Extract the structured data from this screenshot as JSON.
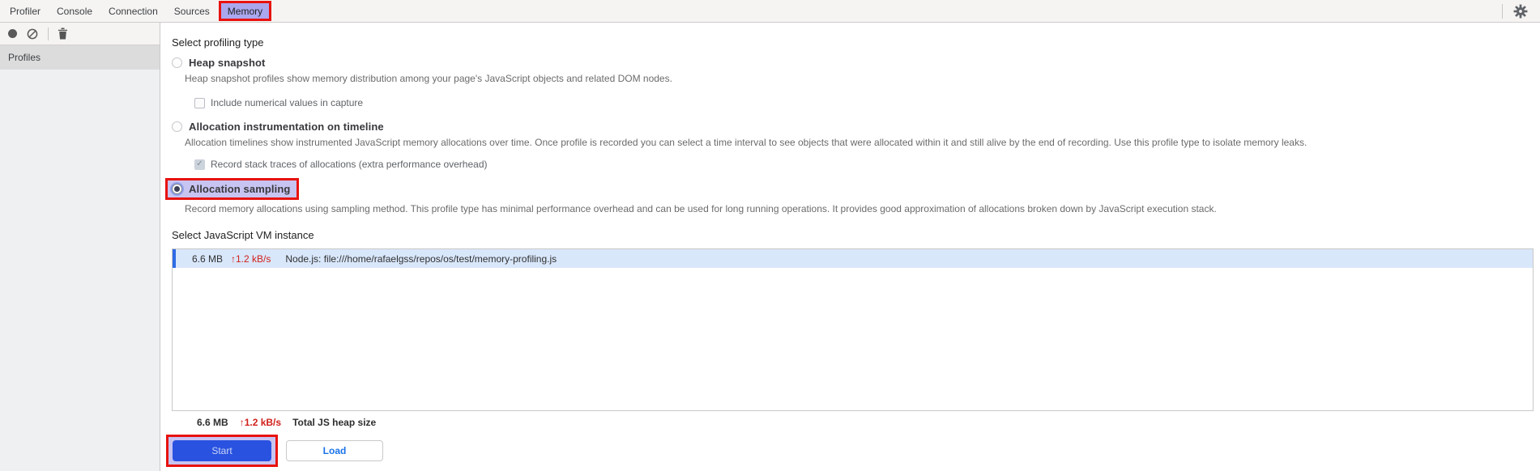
{
  "tabs": {
    "items": [
      {
        "label": "Profiler"
      },
      {
        "label": "Console"
      },
      {
        "label": "Connection"
      },
      {
        "label": "Sources"
      },
      {
        "label": "Memory"
      }
    ],
    "selected": "Memory"
  },
  "sidebar": {
    "header": "Profiles"
  },
  "main": {
    "profiling_heading": "Select profiling type",
    "options": [
      {
        "label": "Heap snapshot",
        "description": "Heap snapshot profiles show memory distribution among your page's JavaScript objects and related DOM nodes.",
        "checkbox": {
          "label": "Include numerical values in capture",
          "checked": false,
          "checkmark": ""
        }
      },
      {
        "label": "Allocation instrumentation on timeline",
        "description": "Allocation timelines show instrumented JavaScript memory allocations over time. Once profile is recorded you can select a time interval to see objects that were allocated within it and still alive by the end of recording. Use this profile type to isolate memory leaks.",
        "checkbox": {
          "label": "Record stack traces of allocations (extra performance overhead)",
          "checked": true,
          "checkmark": "✓"
        }
      },
      {
        "label": "Allocation sampling",
        "description": "Record memory allocations using sampling method. This profile type has minimal performance overhead and can be used for long running operations. It provides good approximation of allocations broken down by JavaScript execution stack.",
        "selected": true
      }
    ],
    "vm_heading": "Select JavaScript VM instance",
    "vm_list": [
      {
        "size": "6.6 MB",
        "arrow": "↑",
        "rate": "1.2 kB/s",
        "title": "Node.js: file:///home/rafaelgss/repos/os/test/memory-profiling.js"
      }
    ],
    "totals": {
      "size": "6.6 MB",
      "arrow": "↑",
      "rate": "1.2 kB/s",
      "label": "Total JS heap size"
    },
    "buttons": {
      "start": "Start",
      "load": "Load"
    }
  },
  "colors": {
    "annotation-red": "#e8120e",
    "annotation-lavender": "#c8c4f2",
    "tab-highlight": "#aba7ee",
    "primary-blue": "#2a52e0",
    "link-blue": "#1a73e8",
    "selection-bg": "#d9e7fb",
    "selection-bar": "#2e6be5",
    "stat-red": "#d0201a"
  }
}
